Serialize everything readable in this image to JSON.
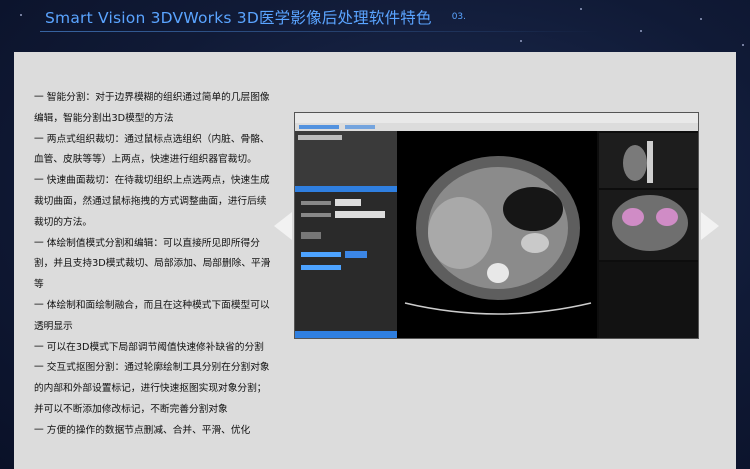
{
  "header": {
    "title": "Smart Vision 3DVWorks 3D医学影像后处理软件特色",
    "page_number": "03."
  },
  "features": [
    "一 智能分割：对于边界模糊的组织通过简单的几层图像编辑，智能分割出3D模型的方法",
    "一 两点式组织裁切：通过鼠标点选组织（内脏、骨骼、血管、皮肤等等）上两点，快速进行组织器官裁切。",
    "一 快速曲面裁切：在待裁切组织上点选两点，快速生成裁切曲面，然通过鼠标拖拽的方式调整曲面，进行后续裁切的方法。",
    "一 体绘制值模式分割和编辑：可以直接所见即所得分割，并且支持3D模式裁切、局部添加、局部删除、平滑等",
    "一 体绘制和面绘制融合，而且在这种模式下面模型可以透明显示",
    "一 可以在3D模式下局部调节阈值快速修补缺省的分割",
    "一 交互式抠图分割：通过轮廓绘制工具分别在分割对象的内部和外部设置标记，进行快速抠图实现对象分割；并可以不断添加修改标记，不断完善分割对象",
    "一 方便的操作的数据节点删减、合并、平滑、优化"
  ],
  "navigation": {
    "previous_icon": "triangle-left-icon",
    "next_icon": "triangle-right-icon"
  },
  "colors": {
    "title": "#5aa4ff",
    "panel": "#dcdcdc",
    "app_accent": "#2f7fe0",
    "background": "#101a36"
  }
}
